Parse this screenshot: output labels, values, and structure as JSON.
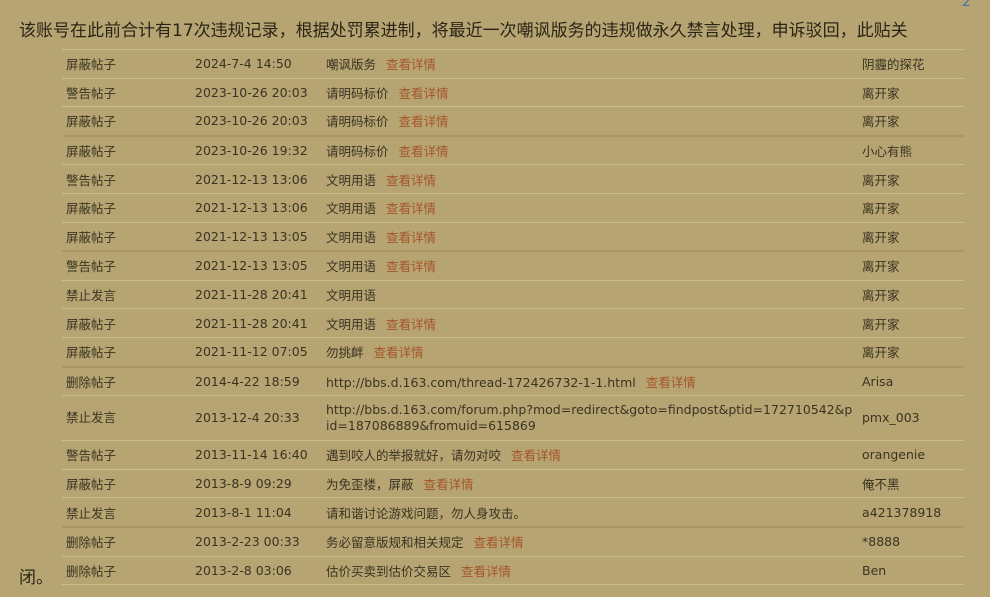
{
  "corner_mark": "2",
  "notice": {
    "line1": "该账号在此前合计有17次违规记录，根据处罚累进制，将最近一次嘲讽版务的违规做永久禁言处理，申诉驳回，此贴关",
    "line2": "闭。"
  },
  "detail_label": "查看详情",
  "records": [
    {
      "action": "屏蔽帖子",
      "date": "2024-7-4 14:50",
      "reason": "嘲讽版务",
      "detail": "查看详情",
      "operator": "阴霾的探花"
    },
    {
      "action": "警告帖子",
      "date": "2023-10-26 20:03",
      "reason": "请明码标价",
      "detail": "查看详情",
      "operator": "离开家"
    },
    {
      "action": "屏蔽帖子",
      "date": "2023-10-26 20:03",
      "reason": "请明码标价",
      "detail": "查看详情",
      "operator": "离开家"
    },
    {
      "action": "屏蔽帖子",
      "date": "2023-10-26 19:32",
      "reason": "请明码标价",
      "detail": "查看详情",
      "operator": "小心有熊"
    },
    {
      "action": "警告帖子",
      "date": "2021-12-13 13:06",
      "reason": "文明用语",
      "detail": "查看详情",
      "operator": "离开家"
    },
    {
      "action": "屏蔽帖子",
      "date": "2021-12-13 13:06",
      "reason": "文明用语",
      "detail": "查看详情",
      "operator": "离开家"
    },
    {
      "action": "屏蔽帖子",
      "date": "2021-12-13 13:05",
      "reason": "文明用语",
      "detail": "查看详情",
      "operator": "离开家"
    },
    {
      "action": "警告帖子",
      "date": "2021-12-13 13:05",
      "reason": "文明用语",
      "detail": "查看详情",
      "operator": "离开家"
    },
    {
      "action": "禁止发言",
      "date": "2021-11-28 20:41",
      "reason": "文明用语",
      "detail": "",
      "operator": "离开家"
    },
    {
      "action": "屏蔽帖子",
      "date": "2021-11-28 20:41",
      "reason": "文明用语",
      "detail": "查看详情",
      "operator": "离开家"
    },
    {
      "action": "屏蔽帖子",
      "date": "2021-11-12 07:05",
      "reason": "勿挑衅",
      "detail": "查看详情",
      "operator": "离开家"
    },
    {
      "action": "删除帖子",
      "date": "2014-4-22 18:59",
      "reason": "http://bbs.d.163.com/thread-172426732-1-1.html",
      "detail": "查看详情",
      "operator": "Arisa"
    },
    {
      "action": "禁止发言",
      "date": "2013-12-4 20:33",
      "reason": "http://bbs.d.163.com/forum.php?mod=redirect&goto=findpost&ptid=172710542&pid=187086889&fromuid=615869",
      "detail": "",
      "operator": "pmx_003"
    },
    {
      "action": "警告帖子",
      "date": "2013-11-14 16:40",
      "reason": "遇到咬人的举报就好，请勿对咬",
      "detail": "查看详情",
      "operator": "orangenie"
    },
    {
      "action": "屏蔽帖子",
      "date": "2013-8-9 09:29",
      "reason": "为免歪楼，屏蔽",
      "detail": "查看详情",
      "operator": "俺不黑"
    },
    {
      "action": "禁止发言",
      "date": "2013-8-1 11:04",
      "reason": "请和谐讨论游戏问题，勿人身攻击。",
      "detail": "",
      "operator": "a421378918"
    },
    {
      "action": "删除帖子",
      "date": "2013-2-23 00:33",
      "reason": "务必留意版规和相关规定",
      "detail": "查看详情",
      "operator": "*8888"
    },
    {
      "action": "删除帖子",
      "date": "2013-2-8 03:06",
      "reason": "估价买卖到估价交易区",
      "detail": "查看详情",
      "operator": "Ben"
    }
  ]
}
